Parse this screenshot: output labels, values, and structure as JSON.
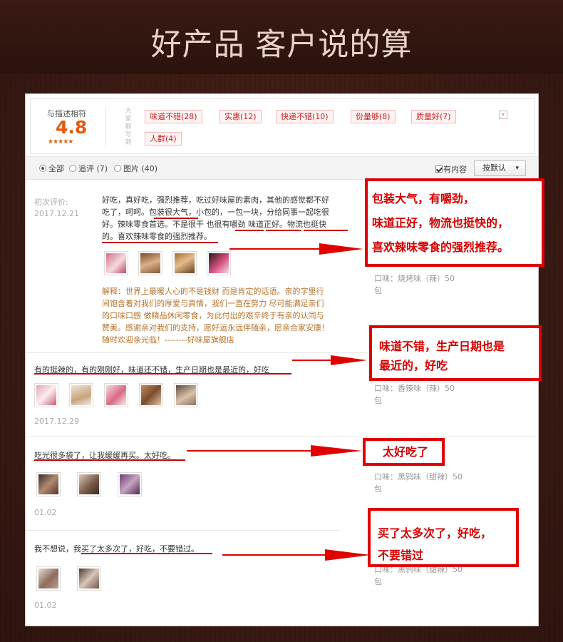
{
  "banner": {
    "title": "好产品 客户说的算"
  },
  "summary": {
    "rating_label": "与描述相符",
    "rating_score": "4.8",
    "stars": "★★★★★",
    "side_label": "大家都写到",
    "tags": [
      "味道不错(28)",
      "实惠(12)",
      "快递不错(10)",
      "份量够(8)",
      "质量好(7)",
      "人群(4)"
    ]
  },
  "filters": {
    "all": "全部",
    "followup": "追评 (7)",
    "pictures": "图片 (40)",
    "has_content": "有内容",
    "sort": "按默认",
    "sort_arrow": "▾"
  },
  "reviews": [
    {
      "first_label": "初次评价:",
      "date": "2017.12.21",
      "text_lines": [
        "好吃，真好吃，强烈推荐，吃过好味屋的素肉，其他的感觉都不好",
        "吃了，呵呵。包装很大气，小包的，一包一块，分给同事一起吃很",
        "好。辣味零食首选。不是很干 也很有嚼劲 味道正好。物流也挺快",
        "的。喜欢辣味零食的强烈推荐。"
      ],
      "reply_lines": [
        "解释：世界上最暖人心的不是钱财 而是肯定的话语。亲的字里行",
        "间饱含着对我们的厚爱与真情，我们一直在努力 尽可能满足亲们",
        "的口味口感 做精品休闲零食，为此付出的艰辛终于有亲的认同与",
        "赞美。感谢亲对我们的支持，愿好运永远伴随亲，愿亲合家安康！",
        "随时欢迎亲光临！--------好味屋旗舰店"
      ],
      "sku_lines": [
        "口味：烧烤味（辣）50",
        "包"
      ]
    },
    {
      "text": "有的挺辣的，有的刚刚好，味道还不错，生产日期也是最近的，好吃",
      "date": "2017.12.29",
      "sku_lines": [
        "口味：香辣味（辣）50",
        "包"
      ]
    },
    {
      "text": "吃光很多袋了，让我缓缓再买。太好吃。",
      "date": "01.02",
      "sku_lines": [
        "口味：黑鸦味（甜辣）50",
        "包"
      ]
    },
    {
      "text": "我不想说，我买了太多次了，好吃，不要错过。",
      "date": "01.02",
      "sku_lines": [
        "口味：黑鸦味（甜辣）50",
        "包"
      ]
    }
  ],
  "callouts": [
    {
      "lines": [
        "包装大气，有嚼劲，",
        "味道正好，物流也挺快的，",
        "喜欢辣味零食的强烈推荐。"
      ]
    },
    {
      "lines": [
        "味道不错，生产日期也是",
        "最近的，好吃"
      ]
    },
    {
      "lines": [
        "太好吃了"
      ]
    },
    {
      "lines": [
        "买了太多次了，好吃，",
        "不要错过"
      ]
    }
  ],
  "colors": {
    "accent": "#e4580c",
    "callout_red": "#e00000",
    "reply_brown": "#b5722a",
    "tag_red": "#c82323"
  }
}
